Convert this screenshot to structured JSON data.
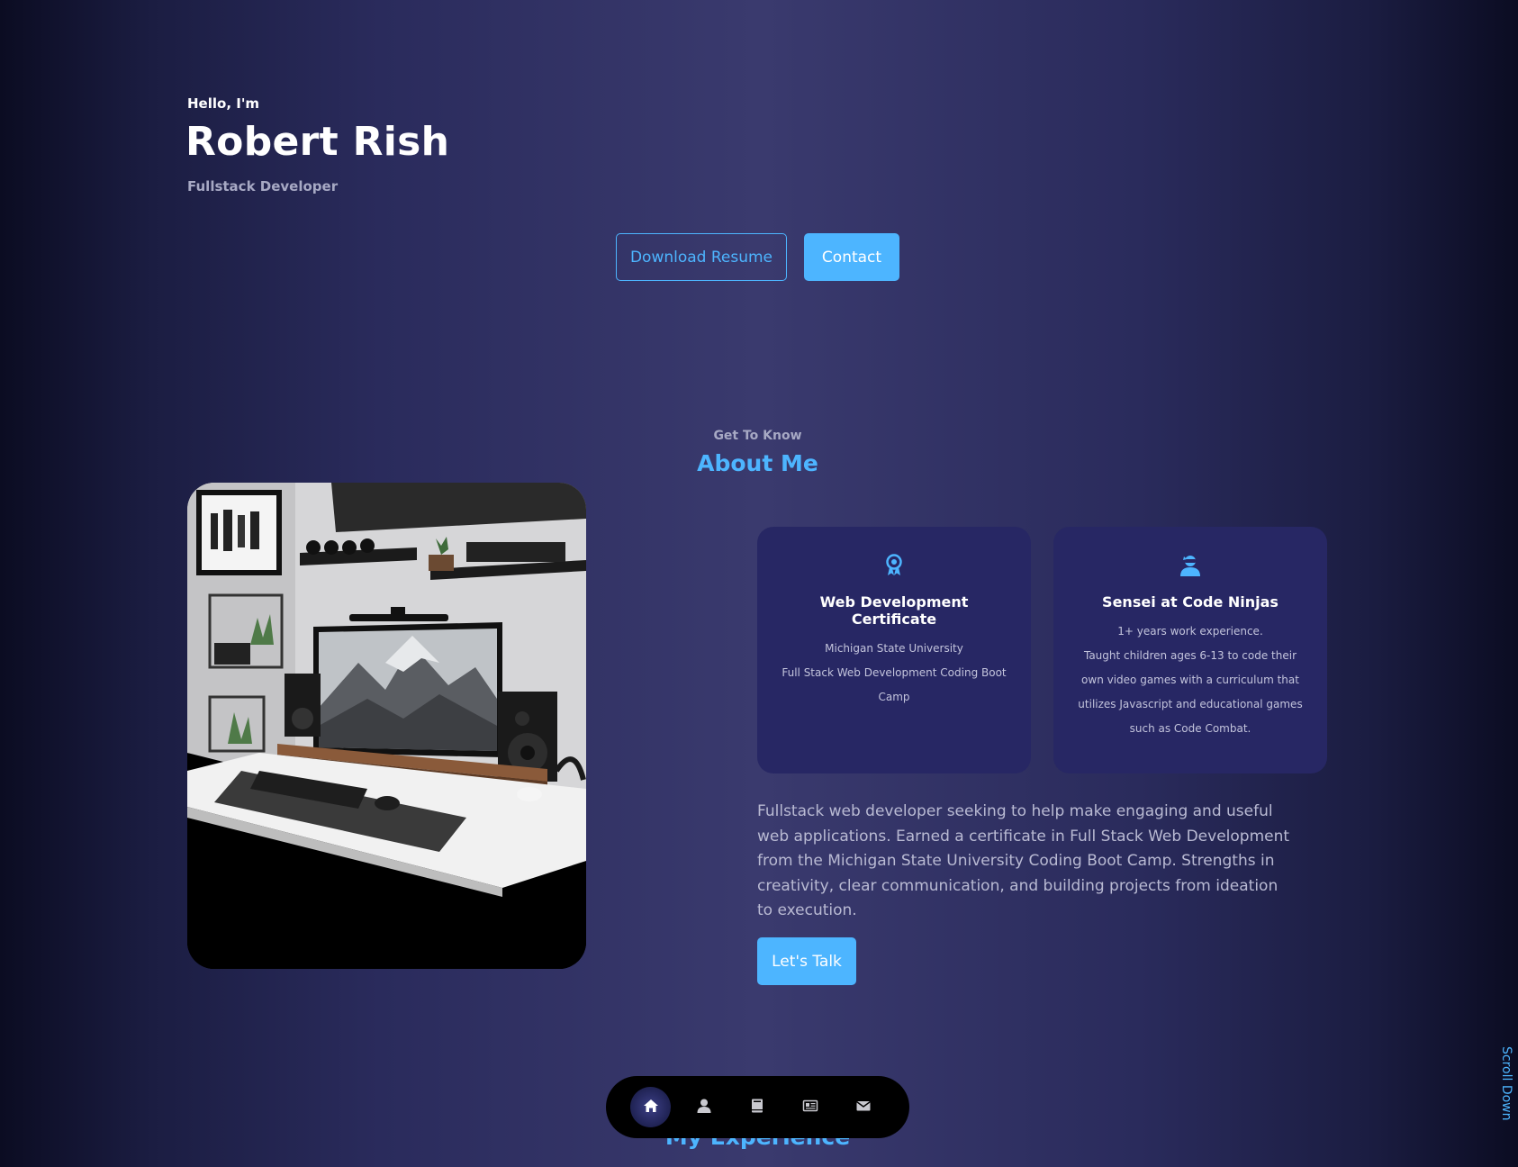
{
  "hero": {
    "greeting": "Hello, I'm",
    "name": "Robert Rish",
    "role": "Fullstack Developer",
    "download_label": "Download Resume",
    "contact_label": "Contact"
  },
  "about": {
    "subtitle": "Get To Know",
    "title": "About Me",
    "cards": [
      {
        "icon": "award-icon",
        "title": "Web Development Certificate",
        "lines": [
          "Michigan State University",
          "Full Stack Web Development Coding Boot",
          "Camp"
        ]
      },
      {
        "icon": "user-ninja-icon",
        "title": "Sensei at Code Ninjas",
        "lines": [
          "1+ years work experience.",
          "Taught children ages 6-13 to code their",
          "own video games with a curriculum that",
          "utilizes Javascript and educational games",
          "such as Code Combat."
        ]
      }
    ],
    "bio": "Fullstack web developer seeking to help make engaging and useful web applications. Earned a certificate in Full Stack Web Development from the Michigan State University Coding Boot Camp. Strengths in creativity, clear communication, and building projects from ideation to execution.",
    "talk_label": "Let's Talk"
  },
  "next_section": {
    "title": "My Experience"
  },
  "nav": {
    "items": [
      {
        "icon": "home-icon",
        "active": true
      },
      {
        "icon": "user-icon",
        "active": false
      },
      {
        "icon": "book-icon",
        "active": false
      },
      {
        "icon": "newspaper-icon",
        "active": false
      },
      {
        "icon": "mail-icon",
        "active": false
      }
    ]
  },
  "scroll_down": "Scroll Down",
  "colors": {
    "accent": "#4db5ff",
    "card_bg": "#272764",
    "text_muted": "#a7a9c4"
  }
}
